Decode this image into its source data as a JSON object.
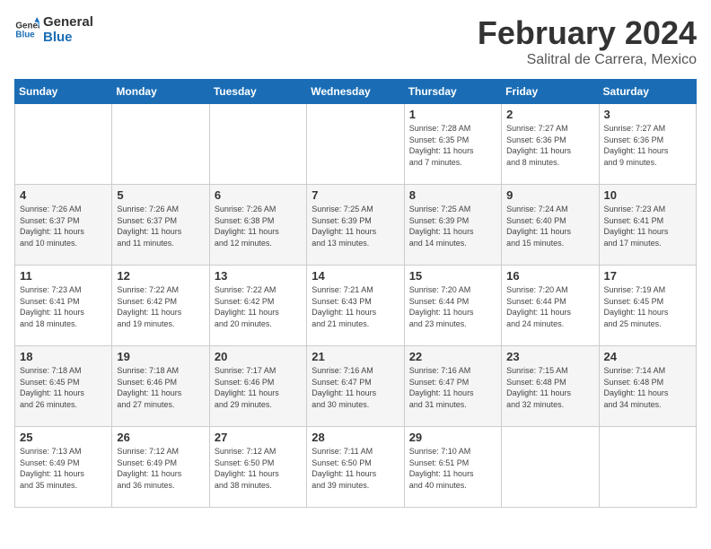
{
  "logo": {
    "line1": "General",
    "line2": "Blue"
  },
  "title": "February 2024",
  "subtitle": "Salitral de Carrera, Mexico",
  "days_of_week": [
    "Sunday",
    "Monday",
    "Tuesday",
    "Wednesday",
    "Thursday",
    "Friday",
    "Saturday"
  ],
  "weeks": [
    [
      {
        "day": "",
        "info": ""
      },
      {
        "day": "",
        "info": ""
      },
      {
        "day": "",
        "info": ""
      },
      {
        "day": "",
        "info": ""
      },
      {
        "day": "1",
        "info": "Sunrise: 7:28 AM\nSunset: 6:35 PM\nDaylight: 11 hours\nand 7 minutes."
      },
      {
        "day": "2",
        "info": "Sunrise: 7:27 AM\nSunset: 6:36 PM\nDaylight: 11 hours\nand 8 minutes."
      },
      {
        "day": "3",
        "info": "Sunrise: 7:27 AM\nSunset: 6:36 PM\nDaylight: 11 hours\nand 9 minutes."
      }
    ],
    [
      {
        "day": "4",
        "info": "Sunrise: 7:26 AM\nSunset: 6:37 PM\nDaylight: 11 hours\nand 10 minutes."
      },
      {
        "day": "5",
        "info": "Sunrise: 7:26 AM\nSunset: 6:37 PM\nDaylight: 11 hours\nand 11 minutes."
      },
      {
        "day": "6",
        "info": "Sunrise: 7:26 AM\nSunset: 6:38 PM\nDaylight: 11 hours\nand 12 minutes."
      },
      {
        "day": "7",
        "info": "Sunrise: 7:25 AM\nSunset: 6:39 PM\nDaylight: 11 hours\nand 13 minutes."
      },
      {
        "day": "8",
        "info": "Sunrise: 7:25 AM\nSunset: 6:39 PM\nDaylight: 11 hours\nand 14 minutes."
      },
      {
        "day": "9",
        "info": "Sunrise: 7:24 AM\nSunset: 6:40 PM\nDaylight: 11 hours\nand 15 minutes."
      },
      {
        "day": "10",
        "info": "Sunrise: 7:23 AM\nSunset: 6:41 PM\nDaylight: 11 hours\nand 17 minutes."
      }
    ],
    [
      {
        "day": "11",
        "info": "Sunrise: 7:23 AM\nSunset: 6:41 PM\nDaylight: 11 hours\nand 18 minutes."
      },
      {
        "day": "12",
        "info": "Sunrise: 7:22 AM\nSunset: 6:42 PM\nDaylight: 11 hours\nand 19 minutes."
      },
      {
        "day": "13",
        "info": "Sunrise: 7:22 AM\nSunset: 6:42 PM\nDaylight: 11 hours\nand 20 minutes."
      },
      {
        "day": "14",
        "info": "Sunrise: 7:21 AM\nSunset: 6:43 PM\nDaylight: 11 hours\nand 21 minutes."
      },
      {
        "day": "15",
        "info": "Sunrise: 7:20 AM\nSunset: 6:44 PM\nDaylight: 11 hours\nand 23 minutes."
      },
      {
        "day": "16",
        "info": "Sunrise: 7:20 AM\nSunset: 6:44 PM\nDaylight: 11 hours\nand 24 minutes."
      },
      {
        "day": "17",
        "info": "Sunrise: 7:19 AM\nSunset: 6:45 PM\nDaylight: 11 hours\nand 25 minutes."
      }
    ],
    [
      {
        "day": "18",
        "info": "Sunrise: 7:18 AM\nSunset: 6:45 PM\nDaylight: 11 hours\nand 26 minutes."
      },
      {
        "day": "19",
        "info": "Sunrise: 7:18 AM\nSunset: 6:46 PM\nDaylight: 11 hours\nand 27 minutes."
      },
      {
        "day": "20",
        "info": "Sunrise: 7:17 AM\nSunset: 6:46 PM\nDaylight: 11 hours\nand 29 minutes."
      },
      {
        "day": "21",
        "info": "Sunrise: 7:16 AM\nSunset: 6:47 PM\nDaylight: 11 hours\nand 30 minutes."
      },
      {
        "day": "22",
        "info": "Sunrise: 7:16 AM\nSunset: 6:47 PM\nDaylight: 11 hours\nand 31 minutes."
      },
      {
        "day": "23",
        "info": "Sunrise: 7:15 AM\nSunset: 6:48 PM\nDaylight: 11 hours\nand 32 minutes."
      },
      {
        "day": "24",
        "info": "Sunrise: 7:14 AM\nSunset: 6:48 PM\nDaylight: 11 hours\nand 34 minutes."
      }
    ],
    [
      {
        "day": "25",
        "info": "Sunrise: 7:13 AM\nSunset: 6:49 PM\nDaylight: 11 hours\nand 35 minutes."
      },
      {
        "day": "26",
        "info": "Sunrise: 7:12 AM\nSunset: 6:49 PM\nDaylight: 11 hours\nand 36 minutes."
      },
      {
        "day": "27",
        "info": "Sunrise: 7:12 AM\nSunset: 6:50 PM\nDaylight: 11 hours\nand 38 minutes."
      },
      {
        "day": "28",
        "info": "Sunrise: 7:11 AM\nSunset: 6:50 PM\nDaylight: 11 hours\nand 39 minutes."
      },
      {
        "day": "29",
        "info": "Sunrise: 7:10 AM\nSunset: 6:51 PM\nDaylight: 11 hours\nand 40 minutes."
      },
      {
        "day": "",
        "info": ""
      },
      {
        "day": "",
        "info": ""
      }
    ]
  ]
}
